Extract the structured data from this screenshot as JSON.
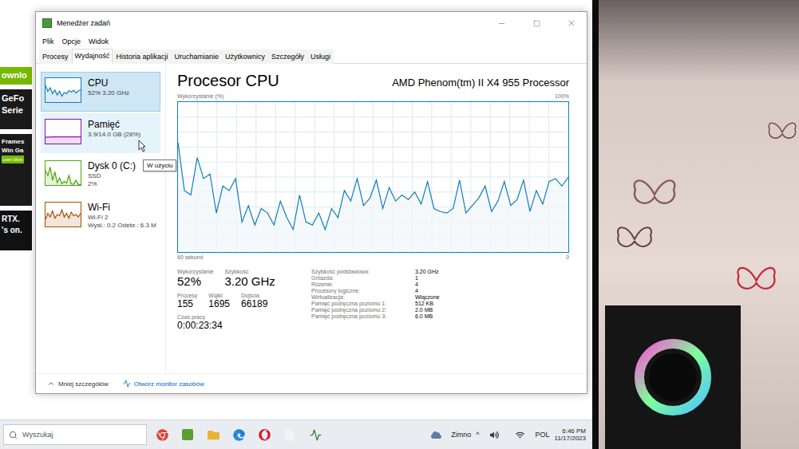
{
  "browser": {
    "heading": "ownlo",
    "ad_lines": [
      "GeFo",
      "Serie"
    ],
    "promo_lines": [
      "Frames",
      "Win Ga"
    ],
    "button": "Learn More",
    "bottom_lines": [
      "RTX.",
      "'s on."
    ]
  },
  "window": {
    "title": "Menedżer zadań"
  },
  "menu": [
    "Plik",
    "Opcje",
    "Widok"
  ],
  "tabs": [
    {
      "label": "Procesy",
      "selected": false
    },
    {
      "label": "Wydajność",
      "selected": true
    },
    {
      "label": "Historia aplikacji",
      "selected": false
    },
    {
      "label": "Uruchamianie",
      "selected": false
    },
    {
      "label": "Użytkownicy",
      "selected": false
    },
    {
      "label": "Szczegóły",
      "selected": false
    },
    {
      "label": "Usługi",
      "selected": false
    }
  ],
  "sidebar": {
    "items": [
      {
        "name": "CPU",
        "details": [
          "52% 3.20 GHz"
        ],
        "selected": true,
        "hovered": false,
        "color": "#117dbb",
        "values": [
          70,
          45,
          60,
          35,
          50,
          30,
          45,
          25,
          40,
          35,
          48,
          42,
          50,
          38,
          46,
          52
        ]
      },
      {
        "name": "Pamięć",
        "details": [
          "3.9/14.0 GB (28%)"
        ],
        "selected": false,
        "hovered": true,
        "color": "#8b12ae",
        "values": [
          26,
          27,
          27,
          28,
          28,
          28,
          28,
          28,
          28,
          28,
          28,
          28,
          28,
          28,
          28,
          28
        ]
      },
      {
        "name": "Dysk 0 (C:)",
        "details": [
          "SSD",
          "2%"
        ],
        "selected": false,
        "hovered": false,
        "color": "#4da60c",
        "values": [
          60,
          40,
          75,
          20,
          55,
          10,
          30,
          5,
          15,
          8,
          40,
          5,
          3,
          20,
          2,
          2
        ]
      },
      {
        "name": "Wi-Fi",
        "details": [
          "Wi-Fi 2",
          "Wysł.: 0.2 Odebr.: 6.3 M"
        ],
        "selected": false,
        "hovered": false,
        "color": "#a74f01",
        "values": [
          30,
          55,
          40,
          65,
          35,
          50,
          45,
          70,
          40,
          55,
          35,
          60,
          45,
          50,
          40,
          55
        ]
      }
    ]
  },
  "tooltip": {
    "text": "W użyciu"
  },
  "panel": {
    "title": "Procesor CPU",
    "model": "AMD Phenom(tm) II X4 955 Processor",
    "chart": {
      "y_label": "Wykorzystanie (%)",
      "y_max": "100%",
      "x_label": "60 sekund",
      "x_end": "0",
      "values": [
        73,
        41,
        38,
        63,
        49,
        52,
        26,
        44,
        41,
        49,
        20,
        31,
        18,
        29,
        26,
        18,
        34,
        23,
        15,
        38,
        20,
        18,
        26,
        15,
        29,
        23,
        41,
        34,
        49,
        31,
        36,
        48,
        29,
        43,
        34,
        38,
        35,
        40,
        32,
        47,
        29,
        27,
        26,
        29,
        48,
        26,
        31,
        36,
        44,
        27,
        34,
        47,
        31,
        35,
        48,
        27,
        41,
        32,
        47,
        49,
        44,
        50
      ]
    },
    "stats": [
      {
        "label": "Wykorzystanie",
        "value": "52%"
      },
      {
        "label": "Szybkość",
        "value": "3.20 GHz"
      }
    ],
    "counts": [
      {
        "label": "Procesy",
        "value": "155"
      },
      {
        "label": "Wątki",
        "value": "1695"
      },
      {
        "label": "Dojścia",
        "value": "66189"
      }
    ],
    "uptime": {
      "label": "Czas pracy",
      "value": "0:00:23:34"
    },
    "details": [
      {
        "label": "Szybkość podstawowa:",
        "value": "3.20 GHz"
      },
      {
        "label": "Gniazda:",
        "value": "1"
      },
      {
        "label": "Rdzenie:",
        "value": "4"
      },
      {
        "label": "Procesory logiczne:",
        "value": "4"
      },
      {
        "label": "Wirtualizacja:",
        "value": "Włączone"
      },
      {
        "label": "Pamięć podręczna poziomu 1:",
        "value": "512 KB"
      },
      {
        "label": "Pamięć podręczna poziomu 2:",
        "value": "2.0 MB"
      },
      {
        "label": "Pamięć podręczna poziomu 3:",
        "value": "6.0 MB"
      }
    ]
  },
  "footer": {
    "less": "Mniej szczegółów",
    "monitor": "Otwórz monitor zasobów"
  },
  "taskbar": {
    "search": "Wyszukaj",
    "weather": "Zimno",
    "tray_toggle": "^",
    "language": "POL",
    "time": "6:46 PM",
    "date": "11/17/2023"
  }
}
